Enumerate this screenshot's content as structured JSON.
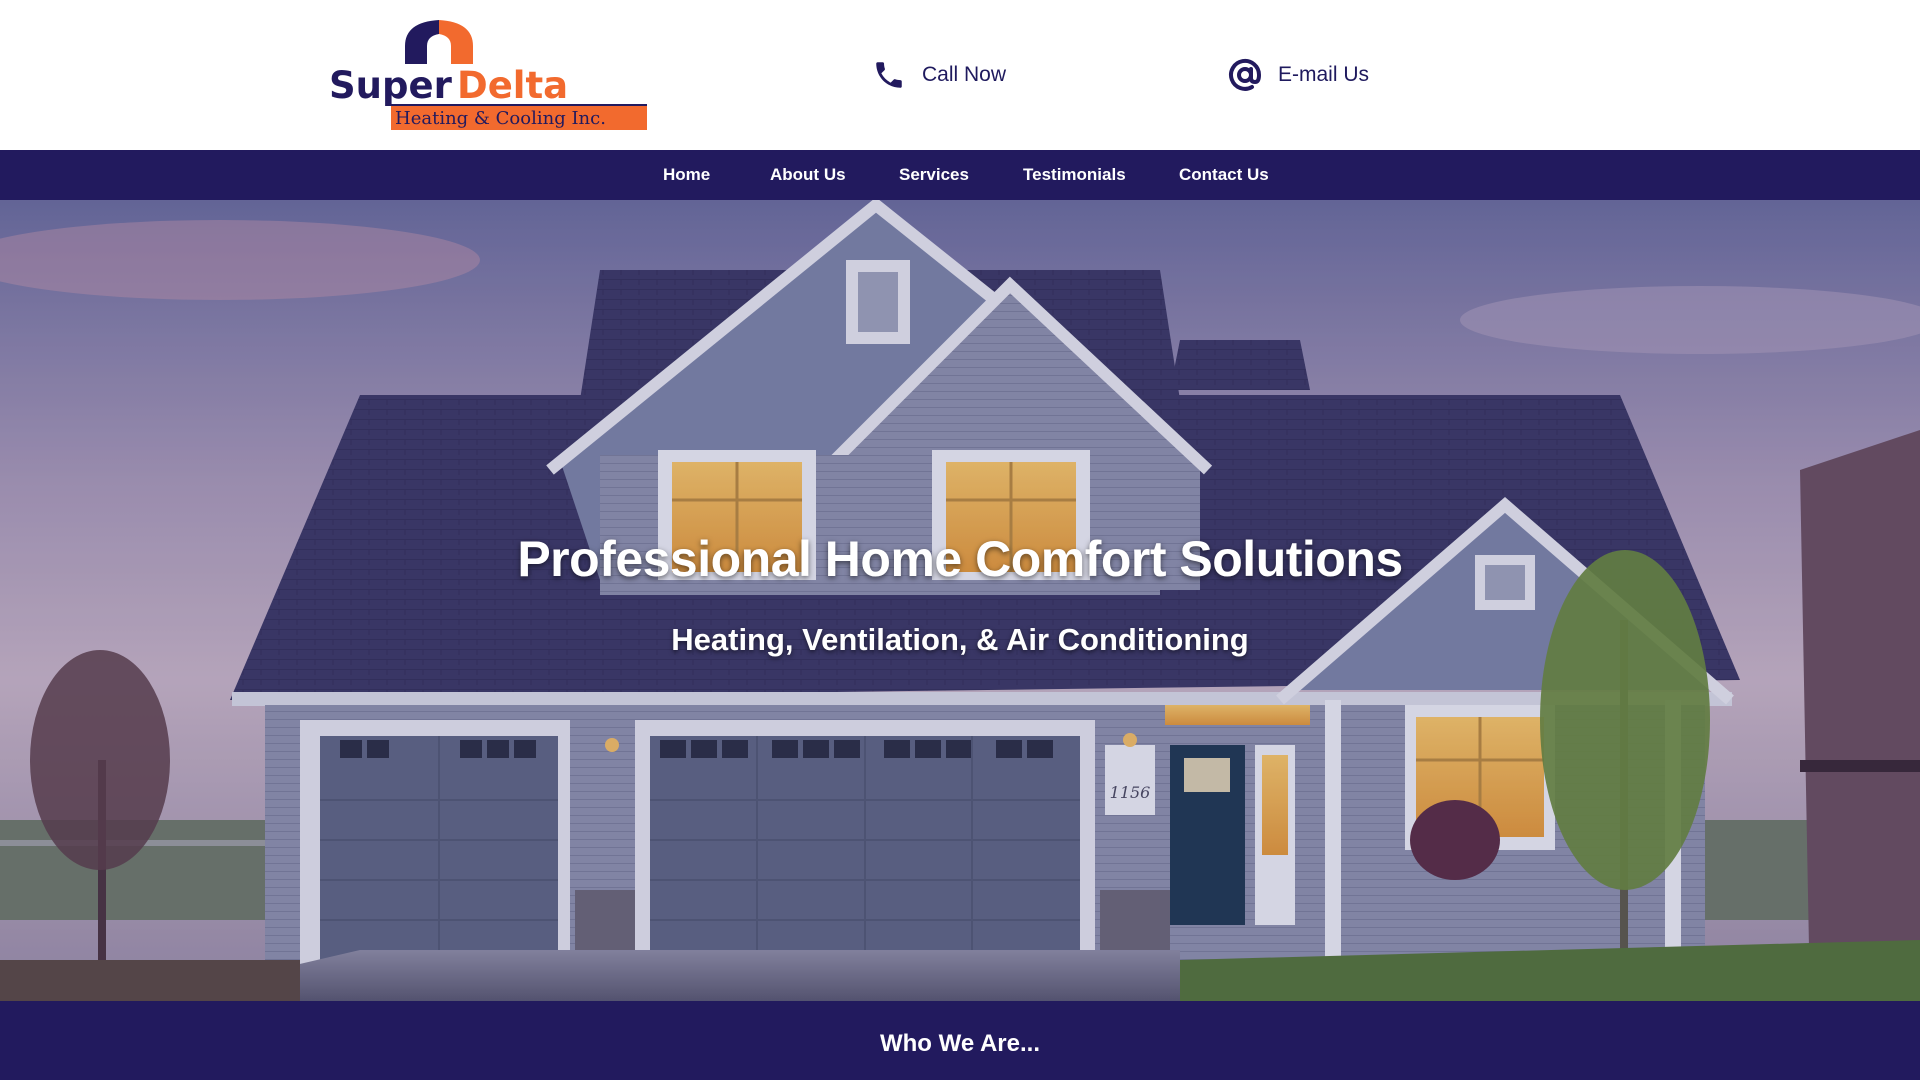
{
  "brand": {
    "name_part1": "Super",
    "name_part2": "Delta",
    "tagline": "Heating & Cooling Inc.",
    "colors": {
      "navy": "#221a5e",
      "orange": "#f26a2e"
    }
  },
  "header": {
    "call_label": "Call Now",
    "call_icon": "phone-icon",
    "email_label": "E-mail Us",
    "email_icon": "at-sign-icon"
  },
  "nav": {
    "items": [
      "Home",
      "About Us",
      "Services",
      "Testimonials",
      "Contact Us"
    ]
  },
  "hero": {
    "title": "Professional Home Comfort Solutions",
    "subtitle": "Heating, Ventilation, & Air Conditioning",
    "house_number": "1156"
  },
  "section": {
    "title": "Who We Are..."
  }
}
